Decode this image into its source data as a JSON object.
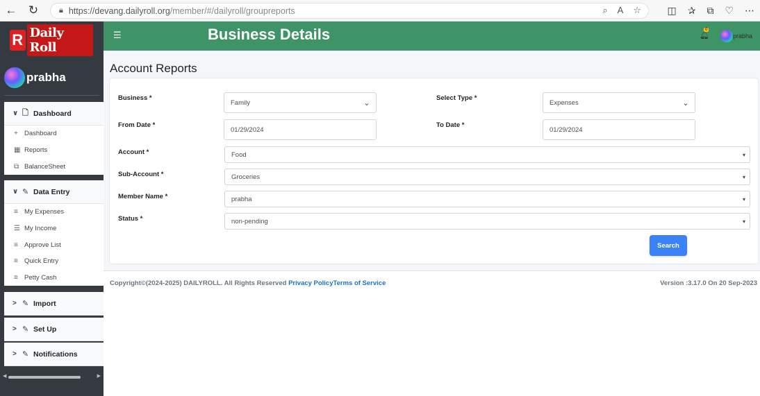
{
  "browser": {
    "url_prefix": "https://devang.dailyroll.org",
    "url_rest": "/member/#/dailyroll/groupreports"
  },
  "sidebar": {
    "logo_letter": "R",
    "logo_text": "Daily Roll",
    "user_name": "prabha",
    "sections": [
      {
        "label": "Dashboard",
        "items": [
          "Dashboard",
          "Reports",
          "BalanceSheet"
        ]
      },
      {
        "label": "Data Entry",
        "items": [
          "My Expenses",
          "My Income",
          "Approve List",
          "Quick Entry",
          "Petty Cash"
        ]
      },
      {
        "label": "Import"
      },
      {
        "label": "Set Up"
      },
      {
        "label": "Notifications"
      }
    ]
  },
  "header": {
    "title": "Business Details",
    "notification_count": "0",
    "user_name": "prabha"
  },
  "page": {
    "title": "Account Reports"
  },
  "form": {
    "business": {
      "label": "Business *",
      "value": "Family"
    },
    "select_type": {
      "label": "Select Type *",
      "value": "Expenses"
    },
    "from_date": {
      "label": "From Date *",
      "value": "01/29/2024"
    },
    "to_date": {
      "label": "To Date *",
      "value": "01/29/2024"
    },
    "account": {
      "label": "Account *",
      "value": "Food"
    },
    "sub_account": {
      "label": "Sub-Account *",
      "value": "Groceries"
    },
    "member_name": {
      "label": "Member Name *",
      "value": "prabha"
    },
    "status": {
      "label": "Status *",
      "value": "non-pending"
    },
    "search_label": "Search"
  },
  "footer": {
    "copyright": "Copyright©(2024-2025) DAILYROLL. All Rights Reserved",
    "privacy": "Privacy Policy",
    "terms": "Terms of Service",
    "version": "Version :3.17.0 On 20 Sep-2023"
  }
}
